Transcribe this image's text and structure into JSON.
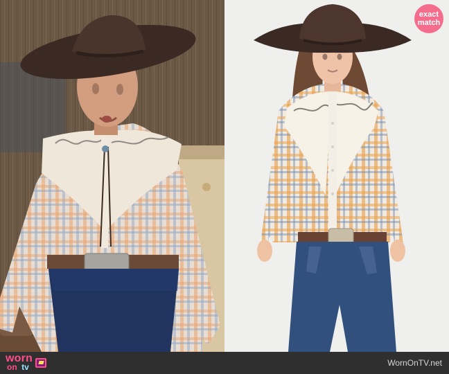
{
  "badges": {
    "exact_match": [
      "exact",
      "match"
    ]
  },
  "footer": {
    "brand_text": "WornOnTV.net",
    "logo_word": "worn",
    "logo_on": "on",
    "logo_tv": "tv"
  },
  "palette": {
    "left_bg": "#3f3a34",
    "right_bg": "#efefed",
    "badge": "#f46d8c",
    "footer": "#2f2f2f"
  }
}
